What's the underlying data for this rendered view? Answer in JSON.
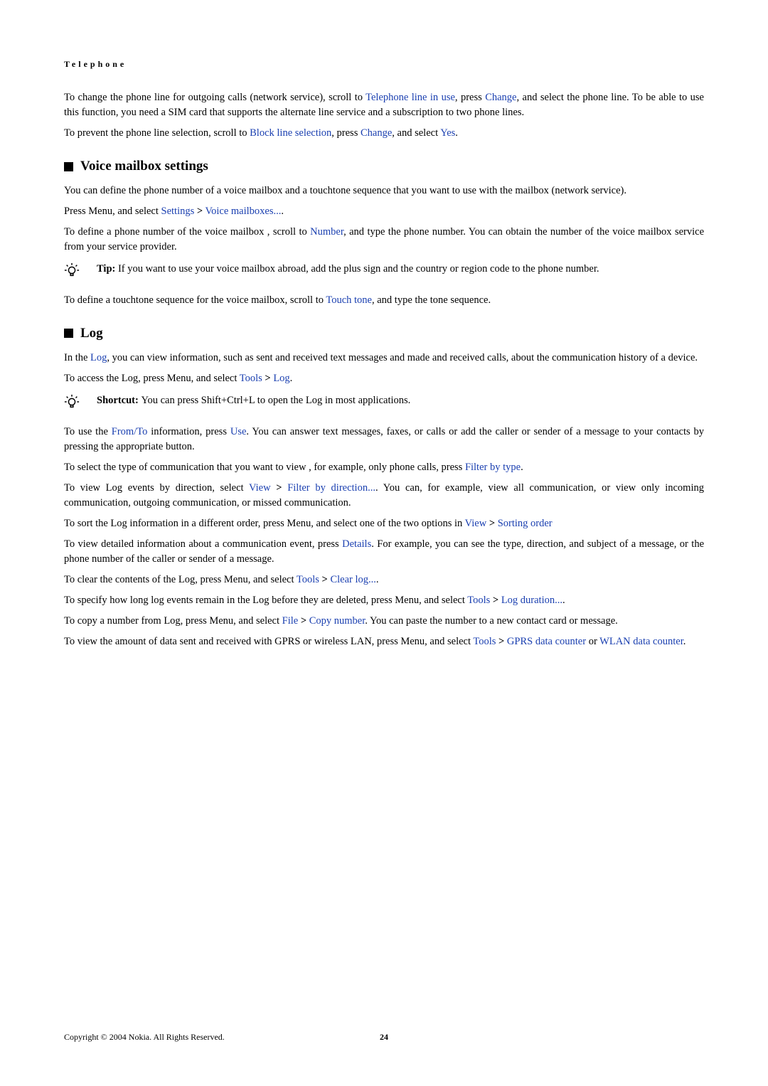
{
  "runningHead": "Telephone",
  "p1": {
    "t1": "To change the phone line for outgoing calls (network service), scroll to ",
    "link1": "Telephone line in use",
    "t2": ", press ",
    "link2": "Change",
    "t3": ", and select the phone line. To be able to use this function, you need a SIM card that supports the alternate line service and a subscription to two phone lines."
  },
  "p2": {
    "t1": "To prevent the phone line selection, scroll to ",
    "link1": "Block line selection",
    "t2": ", press ",
    "link2": "Change",
    "t3": ", and select ",
    "link3": "Yes",
    "t4": "."
  },
  "h1": "Voice mailbox settings",
  "p3": "You can define the phone number of a voice mailbox and a touchtone sequence that you want to use with the mailbox (network service).",
  "p4": {
    "t1": "Press Menu, and select ",
    "link1": "Settings",
    "t2": " ",
    "chev1": ">",
    "t3": " ",
    "link2": "Voice mailboxes...",
    "t4": "."
  },
  "p5": {
    "t1": "To define a phone number of the voice mailbox , scroll to ",
    "link1": "Number",
    "t2": ", and type the phone number. You can obtain the number of the voice mailbox service from your service provider."
  },
  "tip1": {
    "label": "Tip: ",
    "text": "If you want to use your voice mailbox abroad, add the plus sign and the country or region code to the phone number."
  },
  "p6": {
    "t1": "To define a touchtone sequence for the voice mailbox, scroll to ",
    "link1": "Touch tone",
    "t2": ", and type the tone sequence."
  },
  "h2": "Log",
  "p7": {
    "t1": "In the ",
    "link1": "Log",
    "t2": ", you can view information, such as sent and received text messages and made and received calls, about the communication history of a device."
  },
  "p8": {
    "t1": "To access the Log, press Menu, and select ",
    "link1": "Tools",
    "chev1": ">",
    "link2": "Log",
    "t2": "."
  },
  "tip2": {
    "label": "Shortcut: ",
    "text": "You can press Shift+Ctrl+L to open the Log in most applications."
  },
  "p9": {
    "t1": "To use the ",
    "link1": "From/To",
    "t2": " information, press ",
    "link2": "Use",
    "t3": ". You can answer text messages, faxes, or calls or add the caller or sender of a message to your contacts by pressing the appropriate button."
  },
  "p10": {
    "t1": "To select the type of communication that you want to view , for example, only phone calls, press ",
    "link1": "Filter by type",
    "t2": "."
  },
  "p11": {
    "t1": "To view Log events by direction, select ",
    "link1": "View",
    "chev1": ">",
    "link2": "Filter by direction...",
    "t2": ". You can, for example, view all communication, or view only incoming communication, outgoing communication, or missed communication."
  },
  "p12": {
    "t1": "To sort the Log information in a different order, press Menu, and select one of the two options in ",
    "link1": "View",
    "chev1": ">",
    "link2": "Sorting order"
  },
  "p13": {
    "t1": "To view detailed information about a communication event, press ",
    "link1": "Details",
    "t2": ". For example, you can see the type, direction, and subject of a message, or the phone number of the caller or sender of a message."
  },
  "p14": {
    "t1": "To clear the contents of the Log, press Menu, and select ",
    "link1": "Tools",
    "chev1": ">",
    "link2": "Clear log...",
    "t2": "."
  },
  "p15": {
    "t1": "To specify how long log events remain in the Log before they are deleted, press Menu, and select ",
    "link1": "Tools",
    "chev1": ">",
    "link2": "Log duration...",
    "t2": "."
  },
  "p16": {
    "t1": "To copy a number from Log, press Menu, and select ",
    "link1": "File",
    "chev1": ">",
    "link2": "Copy number",
    "t2": ". You can paste the number to a new contact card or message."
  },
  "p17": {
    "t1": "To view the amount of data sent and received with GPRS or wireless LAN, press Menu, and select ",
    "link1": "Tools",
    "chev1": ">",
    "link2": "GPRS data counter",
    "t2": " or ",
    "link3": "WLAN data counter",
    "t3": "."
  },
  "footer": {
    "copyright": "Copyright © 2004 Nokia. All Rights Reserved.",
    "page": "24"
  }
}
